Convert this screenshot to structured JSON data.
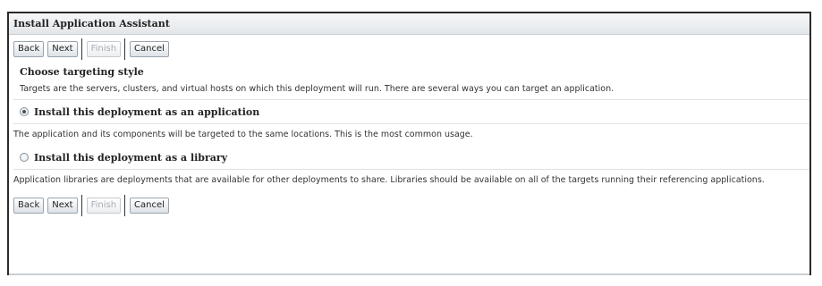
{
  "header": {
    "title": "Install Application Assistant"
  },
  "toolbar_top": {
    "back_label": "Back",
    "next_label": "Next",
    "finish_label": "Finish",
    "cancel_label": "Cancel"
  },
  "section": {
    "title": "Choose targeting style",
    "description": "Targets are the servers, clusters, and virtual hosts on which this deployment will run. There are several ways you can target an application."
  },
  "options": [
    {
      "label": "Install this deployment as an application",
      "selected": true,
      "description": "The application and its components will be targeted to the same locations. This is the most common usage."
    },
    {
      "label": "Install this deployment as a library",
      "selected": false,
      "description": "Application libraries are deployments that are available for other deployments to share. Libraries should be available on all of the targets running their referencing applications."
    }
  ],
  "toolbar_bottom": {
    "back_label": "Back",
    "next_label": "Next",
    "finish_label": "Finish",
    "cancel_label": "Cancel"
  }
}
